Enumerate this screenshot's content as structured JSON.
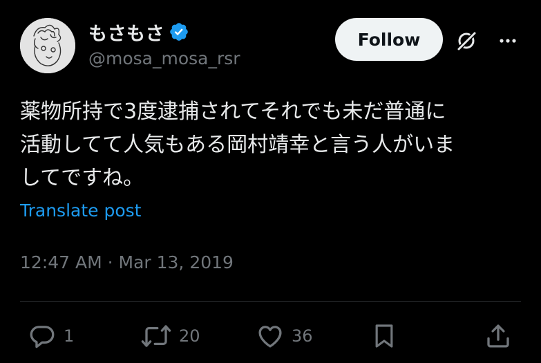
{
  "user": {
    "display_name": "もさもさ",
    "handle": "@mosa_mosa_rsr",
    "verified": true
  },
  "header": {
    "follow_label": "Follow",
    "grok_icon": "grok-slash-icon",
    "more_icon": "more-dots-icon"
  },
  "post": {
    "text": "薬物所持で3度逮捕されてそれでも未だ普通に\n活動してて人気もある岡村靖幸と言う人がいま\nしてですね。",
    "translate_label": "Translate post",
    "timestamp": "12:47 AM · Mar 13, 2019"
  },
  "actions": {
    "replies": "1",
    "reposts": "20",
    "likes": "36"
  },
  "colors": {
    "background": "#000000",
    "text": "#e7e9ea",
    "secondary": "#71767b",
    "link": "#1d9bf0",
    "verified": "#1d9bf0",
    "divider": "#2f3336"
  }
}
